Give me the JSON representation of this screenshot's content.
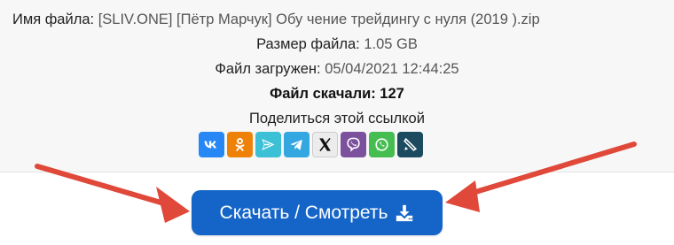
{
  "file_info": {
    "name_label": "Имя файла:",
    "name_value": "[SLIV.ONE] [Пётр Марчук] Обу чение трейдингу с нуля (2019 ).zip",
    "size_label": "Размер файла:",
    "size_value": "1.05 GB",
    "uploaded_label": "Файл загружен:",
    "uploaded_value": "05/04/2021 12:44:25",
    "downloads_label": "Файл скачали:",
    "downloads_value": "127"
  },
  "share": {
    "label": "Поделиться этой ссылкой",
    "icons": [
      "vk-icon",
      "odnoklassniki-icon",
      "icq-icon",
      "telegram-icon",
      "x-twitter-icon",
      "viber-icon",
      "whatsapp-icon",
      "livejournal-icon"
    ]
  },
  "download_button": {
    "label": "Скачать / Смотреть",
    "icon": "download-icon",
    "color": "#1565c8"
  },
  "annotation": {
    "arrow_color": "#e0483a"
  }
}
